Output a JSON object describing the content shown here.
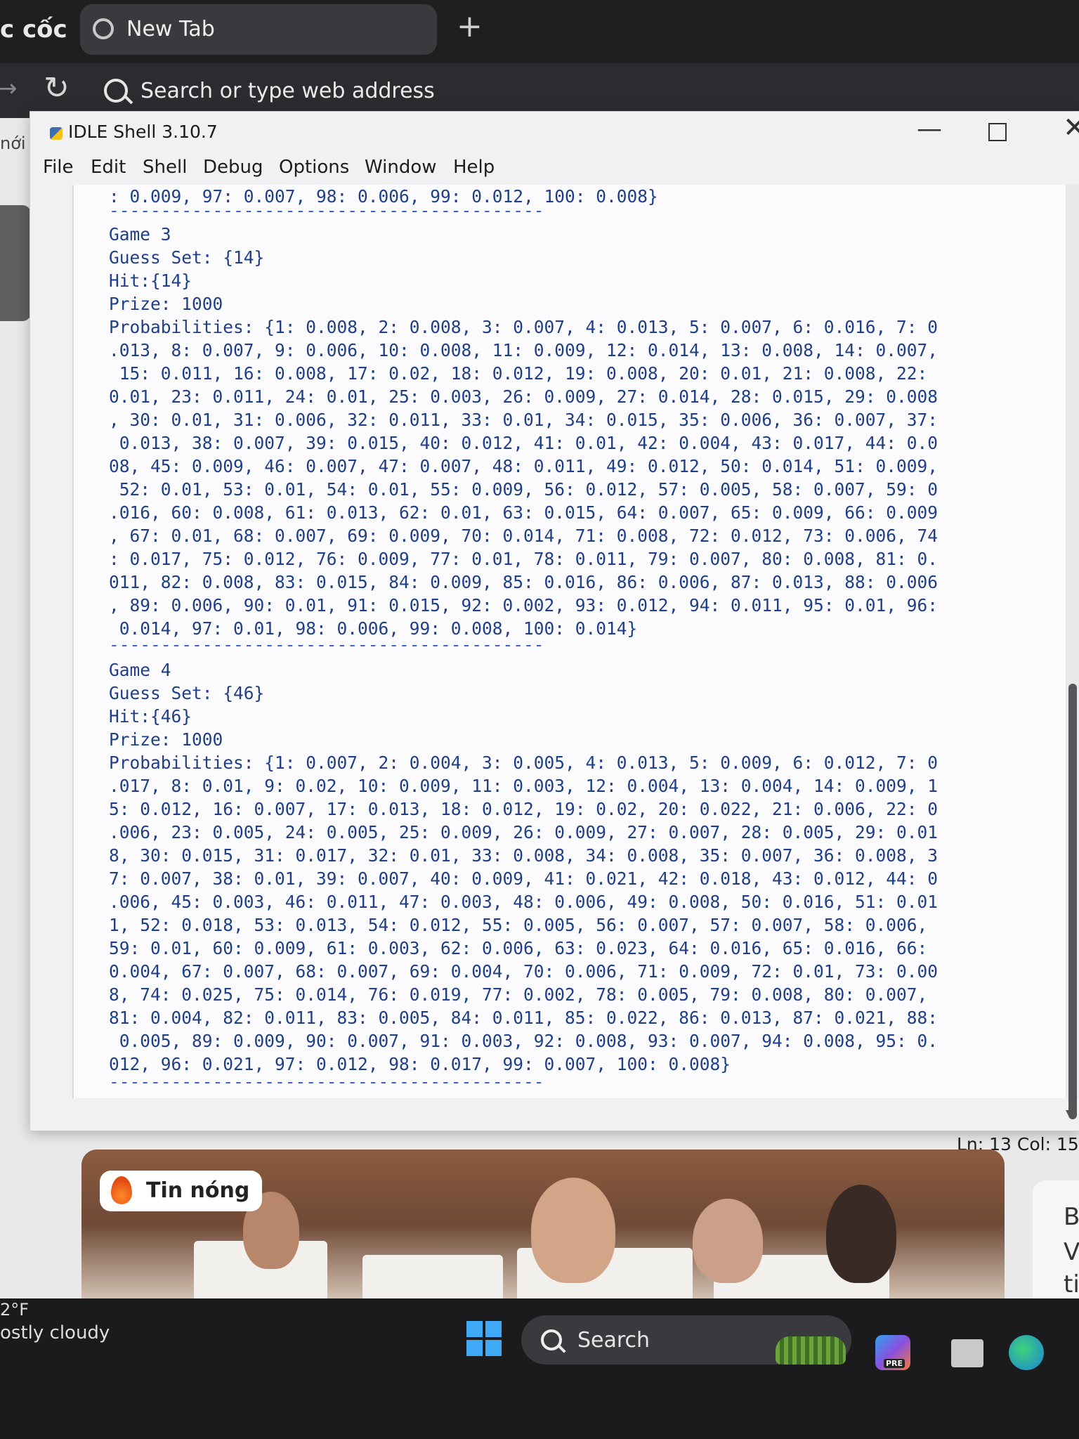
{
  "browser": {
    "brand": "c cốc",
    "tab_title": "New Tab",
    "new_tab_symbol": "+",
    "address_placeholder": "Search or type web address",
    "side_label": "nới"
  },
  "idle": {
    "title": "IDLE Shell 3.10.7",
    "menu": [
      "File",
      "Edit",
      "Shell",
      "Debug",
      "Options",
      "Window",
      "Help"
    ],
    "lines": [
      ": 0.009, 97: 0.007, 98: 0.006, 99: 0.012, 100: 0.008}",
      "------------------------------------------",
      "Game 3",
      "Guess Set: {14}",
      "Hit:{14}",
      "Prize: 1000",
      "Probabilities: {1: 0.008, 2: 0.008, 3: 0.007, 4: 0.013, 5: 0.007, 6: 0.016, 7: 0",
      ".013, 8: 0.007, 9: 0.006, 10: 0.008, 11: 0.009, 12: 0.014, 13: 0.008, 14: 0.007,",
      " 15: 0.011, 16: 0.008, 17: 0.02, 18: 0.012, 19: 0.008, 20: 0.01, 21: 0.008, 22:",
      "0.01, 23: 0.011, 24: 0.01, 25: 0.003, 26: 0.009, 27: 0.014, 28: 0.015, 29: 0.008",
      ", 30: 0.01, 31: 0.006, 32: 0.011, 33: 0.01, 34: 0.015, 35: 0.006, 36: 0.007, 37:",
      " 0.013, 38: 0.007, 39: 0.015, 40: 0.012, 41: 0.01, 42: 0.004, 43: 0.017, 44: 0.0",
      "08, 45: 0.009, 46: 0.007, 47: 0.007, 48: 0.011, 49: 0.012, 50: 0.014, 51: 0.009,",
      " 52: 0.01, 53: 0.01, 54: 0.01, 55: 0.009, 56: 0.012, 57: 0.005, 58: 0.007, 59: 0",
      ".016, 60: 0.008, 61: 0.013, 62: 0.01, 63: 0.015, 64: 0.007, 65: 0.009, 66: 0.009",
      ", 67: 0.01, 68: 0.007, 69: 0.009, 70: 0.014, 71: 0.008, 72: 0.012, 73: 0.006, 74",
      ": 0.017, 75: 0.012, 76: 0.009, 77: 0.01, 78: 0.011, 79: 0.007, 80: 0.008, 81: 0.",
      "011, 82: 0.008, 83: 0.015, 84: 0.009, 85: 0.016, 86: 0.006, 87: 0.013, 88: 0.006",
      ", 89: 0.006, 90: 0.01, 91: 0.015, 92: 0.002, 93: 0.012, 94: 0.011, 95: 0.01, 96:",
      " 0.014, 97: 0.01, 98: 0.006, 99: 0.008, 100: 0.014}",
      "------------------------------------------",
      "Game 4",
      "Guess Set: {46}",
      "Hit:{46}",
      "Prize: 1000",
      "Probabilities: {1: 0.007, 2: 0.004, 3: 0.005, 4: 0.013, 5: 0.009, 6: 0.012, 7: 0",
      ".017, 8: 0.01, 9: 0.02, 10: 0.009, 11: 0.003, 12: 0.004, 13: 0.004, 14: 0.009, 1",
      "5: 0.012, 16: 0.007, 17: 0.013, 18: 0.012, 19: 0.02, 20: 0.022, 21: 0.006, 22: 0",
      ".006, 23: 0.005, 24: 0.005, 25: 0.009, 26: 0.009, 27: 0.007, 28: 0.005, 29: 0.01",
      "8, 30: 0.015, 31: 0.017, 32: 0.01, 33: 0.008, 34: 0.008, 35: 0.007, 36: 0.008, 3",
      "7: 0.007, 38: 0.01, 39: 0.007, 40: 0.009, 41: 0.021, 42: 0.018, 43: 0.012, 44: 0",
      ".006, 45: 0.003, 46: 0.011, 47: 0.003, 48: 0.006, 49: 0.008, 50: 0.016, 51: 0.01",
      "1, 52: 0.018, 53: 0.013, 54: 0.012, 55: 0.005, 56: 0.007, 57: 0.007, 58: 0.006,",
      "59: 0.01, 60: 0.009, 61: 0.003, 62: 0.006, 63: 0.023, 64: 0.016, 65: 0.016, 66:",
      "0.004, 67: 0.007, 68: 0.007, 69: 0.004, 70: 0.006, 71: 0.009, 72: 0.01, 73: 0.00",
      "8, 74: 0.025, 75: 0.014, 76: 0.019, 77: 0.002, 78: 0.005, 79: 0.008, 80: 0.007,",
      "81: 0.004, 82: 0.011, 83: 0.005, 84: 0.011, 85: 0.022, 86: 0.013, 87: 0.021, 88:",
      " 0.005, 89: 0.009, 90: 0.007, 91: 0.003, 92: 0.008, 93: 0.007, 94: 0.008, 95: 0.",
      "012, 96: 0.021, 97: 0.012, 98: 0.017, 99: 0.007, 100: 0.008}",
      "------------------------------------------"
    ],
    "status": "Ln: 13  Col: 15"
  },
  "news": {
    "badge": "Tin nóng",
    "side_letters": [
      "B",
      "V",
      "ti"
    ]
  },
  "taskbar": {
    "weather_temp": "2°F",
    "weather_text": "ostly cloudy",
    "search_label": "Search",
    "pre_badge": "PRE"
  },
  "colors": {
    "shell_text": "#1f3f86",
    "separator": "#3c64c8",
    "windows_blue": "#3fa9f5"
  }
}
